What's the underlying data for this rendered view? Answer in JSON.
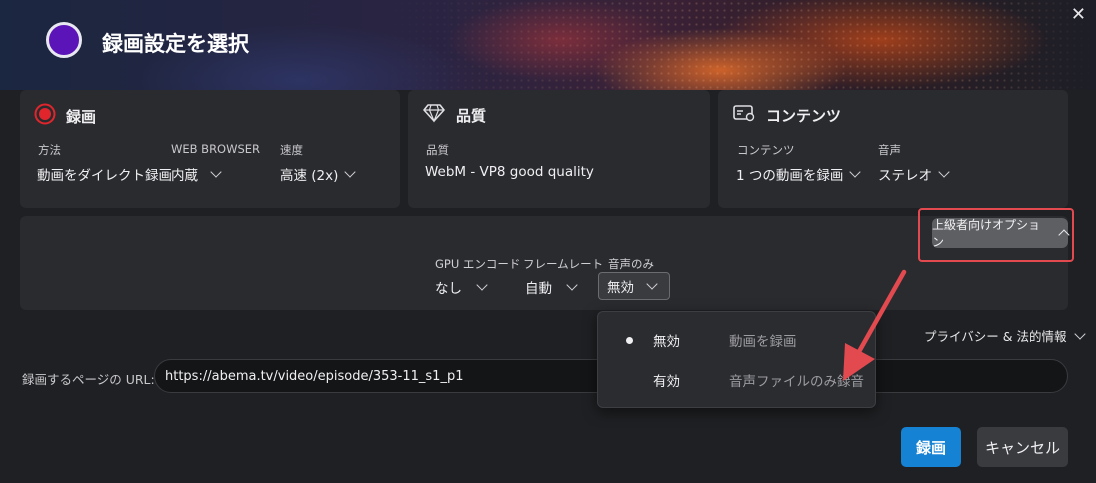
{
  "window": {
    "title": "録画設定を選択",
    "close_icon": "close-icon",
    "close_glyph": "✕"
  },
  "cards": {
    "recording": {
      "title": "録画",
      "icon": "record-icon",
      "fields": [
        {
          "label": "方法",
          "value": "動画をダイレクト録画"
        },
        {
          "label": "WEB BROWSER",
          "value": "内蔵"
        },
        {
          "label": "速度",
          "value": "高速 (2x)"
        }
      ]
    },
    "quality": {
      "title": "品質",
      "icon": "diamond-icon",
      "fields": [
        {
          "label": "品質",
          "value": "WebM - VP8 good quality"
        }
      ]
    },
    "content": {
      "title": "コンテンツ",
      "icon": "content-settings-icon",
      "fields": [
        {
          "label": "コンテンツ",
          "value": "1 つの動画を録画"
        },
        {
          "label": "音声",
          "value": "ステレオ"
        }
      ]
    }
  },
  "advanced": {
    "button_label": "上級者向けオプション",
    "gpu": {
      "label": "GPU エンコード",
      "value": "なし"
    },
    "framerate": {
      "label": "フレームレート",
      "value": "自動"
    },
    "audio_only": {
      "label": "音声のみ",
      "value": "無効"
    }
  },
  "audio_only_options": [
    {
      "label": "無効",
      "description": "動画を録画",
      "selected": true
    },
    {
      "label": "有効",
      "description": "音声ファイルのみ録音",
      "selected": false
    }
  ],
  "privacy_label": "プライバシー & 法的情報",
  "url": {
    "label": "録画するページの URL:",
    "value": "https://abema.tv/video/episode/353-11_s1_p1"
  },
  "actions": {
    "record": "録画",
    "cancel": "キャンセル"
  },
  "colors": {
    "accent": "#1682d4",
    "highlight": "#e24a4f",
    "record_red": "#e0262c",
    "logo_purple": "#5b14b8"
  }
}
